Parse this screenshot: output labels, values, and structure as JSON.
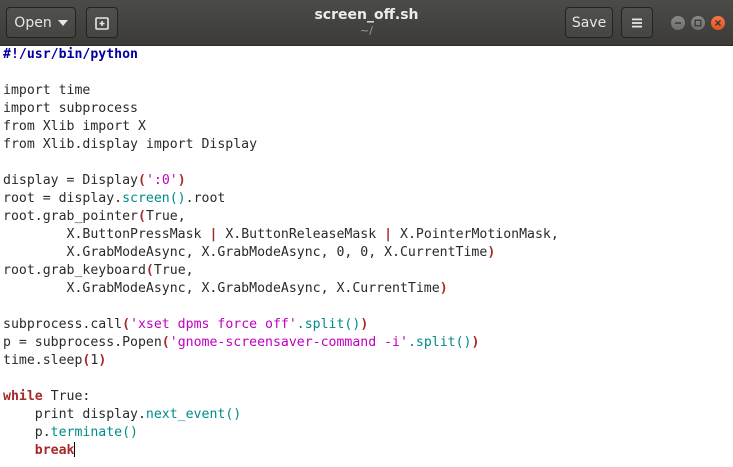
{
  "header": {
    "open_label": "Open",
    "save_label": "Save",
    "title": "screen_off.sh",
    "subtitle": "~/"
  },
  "icons": {
    "new_tab": "new-tab-icon",
    "menu": "hamburger-menu-icon",
    "window_controls": [
      "minimize-icon",
      "maximize-icon",
      "close-icon"
    ]
  },
  "colors": {
    "titlebar": "#3c3b37",
    "shebang": "#0000a0",
    "string": "#c000c0",
    "function": "#008b8b",
    "keyword": "#a52a2a",
    "close_button": "#e95420"
  },
  "code": {
    "shebang": "#!/usr/bin/python",
    "line_import_time": "import time",
    "line_import_subprocess": "import subprocess",
    "line_from_xlib": "from Xlib import X",
    "line_from_xlib_display": "from Xlib.display import Display",
    "display_prefix": "display = Display",
    "display_arg": "':0'",
    "root_prefix": "root = display.",
    "screen_fn": "screen",
    "root_suffix": ".root",
    "grab_pointer_prefix": "root.grab_pointer",
    "grab_pointer_arg1": "True,",
    "masks_a": "        X.ButtonPressMask ",
    "masks_b": " X.ButtonReleaseMask ",
    "masks_c": " X.PointerMotionMask,",
    "pipe": "|",
    "grab_pointer_args2": "        X.GrabModeAsync, X.GrabModeAsync, 0, 0, X.CurrentTime",
    "grab_keyboard_prefix": "root.grab_keyboard",
    "grab_keyboard_arg1": "True,",
    "grab_keyboard_args2": "        X.GrabModeAsync, X.GrabModeAsync, X.CurrentTime",
    "call_prefix": "subprocess.call",
    "call_arg": "'xset dpms force off'",
    "split_fn": ".split",
    "popen_prefix": "p = subprocess.Popen",
    "popen_arg": "'gnome-screensaver-command -i'",
    "sleep_prefix": "time.sleep",
    "sleep_arg": "1",
    "while_kw": "while",
    "while_rest": " True:",
    "print_prefix": "    print display.",
    "next_event_fn": "next_event",
    "p_prefix": "    p.",
    "terminate_fn": "terminate",
    "indent": "    ",
    "break_kw": "break"
  }
}
